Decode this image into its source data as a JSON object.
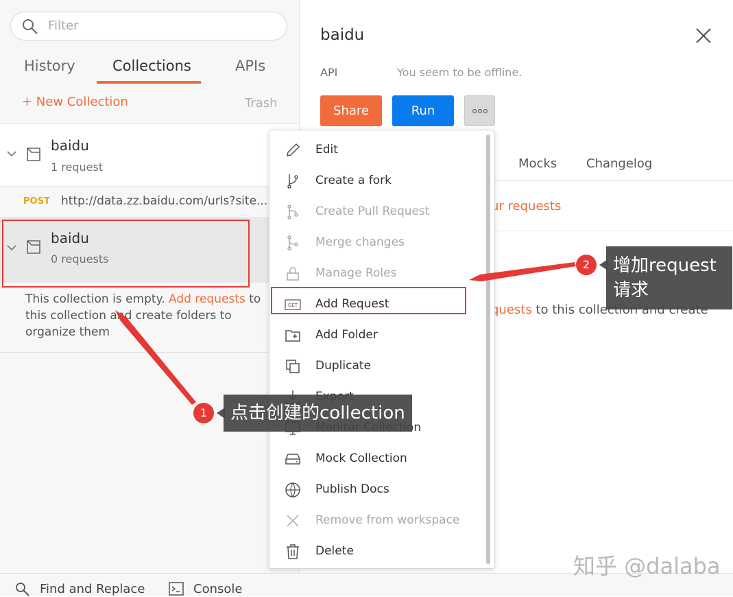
{
  "sidebar": {
    "filter_placeholder": "Filter",
    "tabs": [
      {
        "label": "History"
      },
      {
        "label": "Collections"
      },
      {
        "label": "APIs"
      }
    ],
    "new_collection": "+ New Collection",
    "trash": "Trash",
    "collections": [
      {
        "name": "baidu",
        "count": "1 request"
      },
      {
        "name": "baidu",
        "count": "0 requests"
      }
    ],
    "request": {
      "method": "POST",
      "url": "http://data.zz.baidu.com/urls?site..."
    },
    "empty_text_pre": "This collection is empty. ",
    "empty_text_link": "Add requests",
    "empty_text_post": " to this collection and create folders to organize them"
  },
  "main": {
    "title": "baidu",
    "api_label": "API",
    "offline": "You seem to be offline.",
    "share": "Share",
    "run": "Run",
    "tabs": [
      {
        "label": "Mocks"
      },
      {
        "label": "Changelog"
      }
    ],
    "link_fragment": "ur requests",
    "text_link": "quests",
    "text_rest": " to this collection and create"
  },
  "menu": {
    "items": [
      {
        "label": "Edit",
        "icon": "pencil-icon"
      },
      {
        "label": "Create a fork",
        "icon": "fork-icon"
      },
      {
        "label": "Create Pull Request",
        "icon": "pull-request-icon"
      },
      {
        "label": "Merge changes",
        "icon": "merge-icon"
      },
      {
        "label": "Manage Roles",
        "icon": "lock-icon"
      },
      {
        "label": "Add Request",
        "icon": "get-request-icon"
      },
      {
        "label": "Add Folder",
        "icon": "add-folder-icon"
      },
      {
        "label": "Duplicate",
        "icon": "duplicate-icon"
      },
      {
        "label": "Export",
        "icon": "export-icon"
      },
      {
        "label": "Monitor Collection",
        "icon": "monitor-icon"
      },
      {
        "label": "Mock Collection",
        "icon": "mock-server-icon"
      },
      {
        "label": "Publish Docs",
        "icon": "globe-icon"
      },
      {
        "label": "Remove from workspace",
        "icon": "x-icon"
      },
      {
        "label": "Delete",
        "icon": "trash-icon"
      }
    ]
  },
  "annotations": {
    "badge1": "1",
    "callout1": "点击创建的collection",
    "badge2": "2",
    "callout2_line1": "增加request",
    "callout2_line2": "请求"
  },
  "bottom": {
    "find_replace": "Find and Replace",
    "console": "Console"
  },
  "watermark": "知乎 @dalaba",
  "colors": {
    "accent": "#f26b3a",
    "run_blue": "#097bed",
    "annotation_red": "#e53935"
  }
}
